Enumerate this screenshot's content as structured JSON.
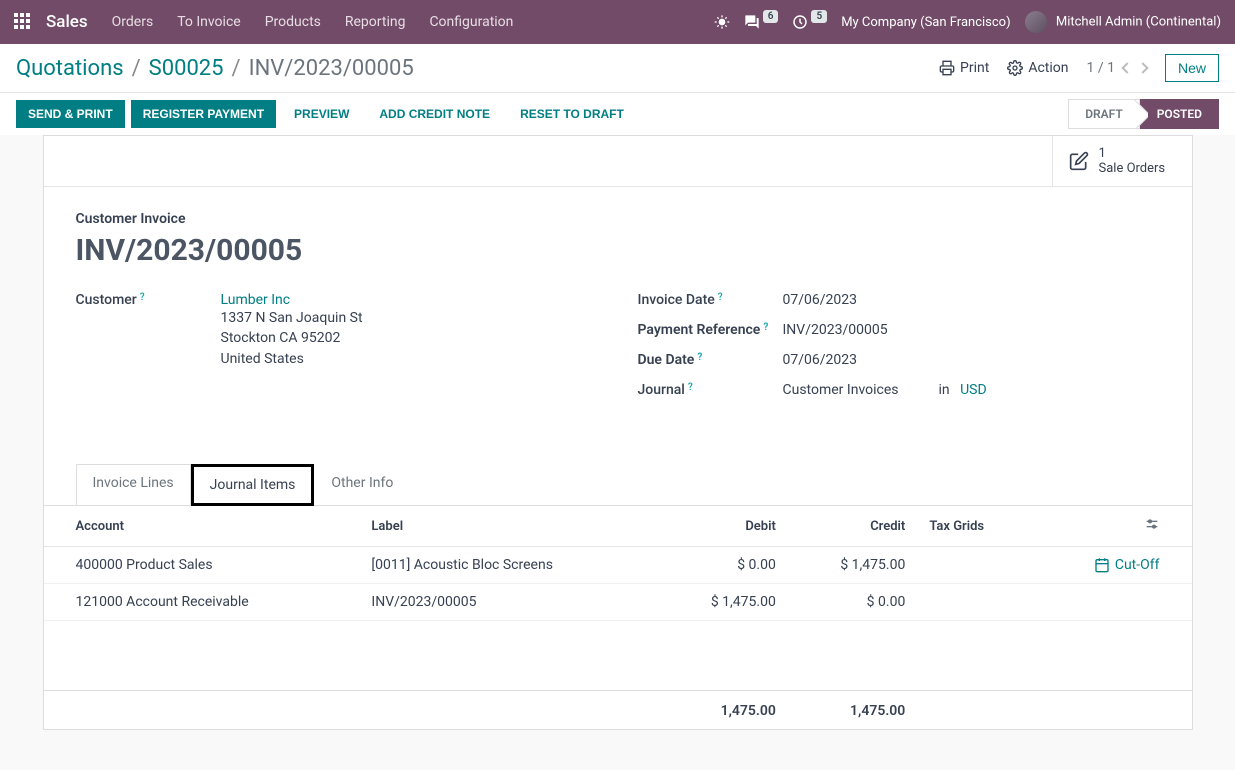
{
  "nav": {
    "brand": "Sales",
    "menu": [
      "Orders",
      "To Invoice",
      "Products",
      "Reporting",
      "Configuration"
    ],
    "messages_badge": "6",
    "activities_badge": "5",
    "company": "My Company (San Francisco)",
    "user": "Mitchell Admin (Continental)"
  },
  "breadcrumb": {
    "root": "Quotations",
    "parent": "S00025",
    "current": "INV/2023/00005"
  },
  "controls": {
    "print": "Print",
    "action": "Action",
    "pager": "1 / 1",
    "new": "New"
  },
  "actions": {
    "send_print": "SEND & PRINT",
    "register_payment": "REGISTER PAYMENT",
    "preview": "PREVIEW",
    "add_credit_note": "ADD CREDIT NOTE",
    "reset_draft": "RESET TO DRAFT"
  },
  "status": {
    "draft": "DRAFT",
    "posted": "POSTED"
  },
  "stat": {
    "count": "1",
    "label": "Sale Orders"
  },
  "doc": {
    "label": "Customer Invoice",
    "title": "INV/2023/00005"
  },
  "customer": {
    "label": "Customer",
    "name": "Lumber Inc",
    "addr1": "1337 N San Joaquin St",
    "addr2": "Stockton CA 95202",
    "addr3": "United States"
  },
  "fields": {
    "invoice_date_label": "Invoice Date",
    "invoice_date": "07/06/2023",
    "payment_ref_label": "Payment Reference",
    "payment_ref": "INV/2023/00005",
    "due_date_label": "Due Date",
    "due_date": "07/06/2023",
    "journal_label": "Journal",
    "journal": "Customer Invoices",
    "in": "in",
    "currency": "USD"
  },
  "tabs": {
    "invoice_lines": "Invoice Lines",
    "journal_items": "Journal Items",
    "other_info": "Other Info"
  },
  "table": {
    "headers": {
      "account": "Account",
      "label": "Label",
      "debit": "Debit",
      "credit": "Credit",
      "tax_grids": "Tax Grids"
    },
    "rows": [
      {
        "account": "400000 Product Sales",
        "label": "[0011] Acoustic Bloc Screens",
        "debit": "$ 0.00",
        "credit": "$ 1,475.00",
        "cutoff": "Cut-Off"
      },
      {
        "account": "121000 Account Receivable",
        "label": "INV/2023/00005",
        "debit": "$ 1,475.00",
        "credit": "$ 0.00",
        "cutoff": ""
      }
    ],
    "totals": {
      "debit": "1,475.00",
      "credit": "1,475.00"
    }
  }
}
